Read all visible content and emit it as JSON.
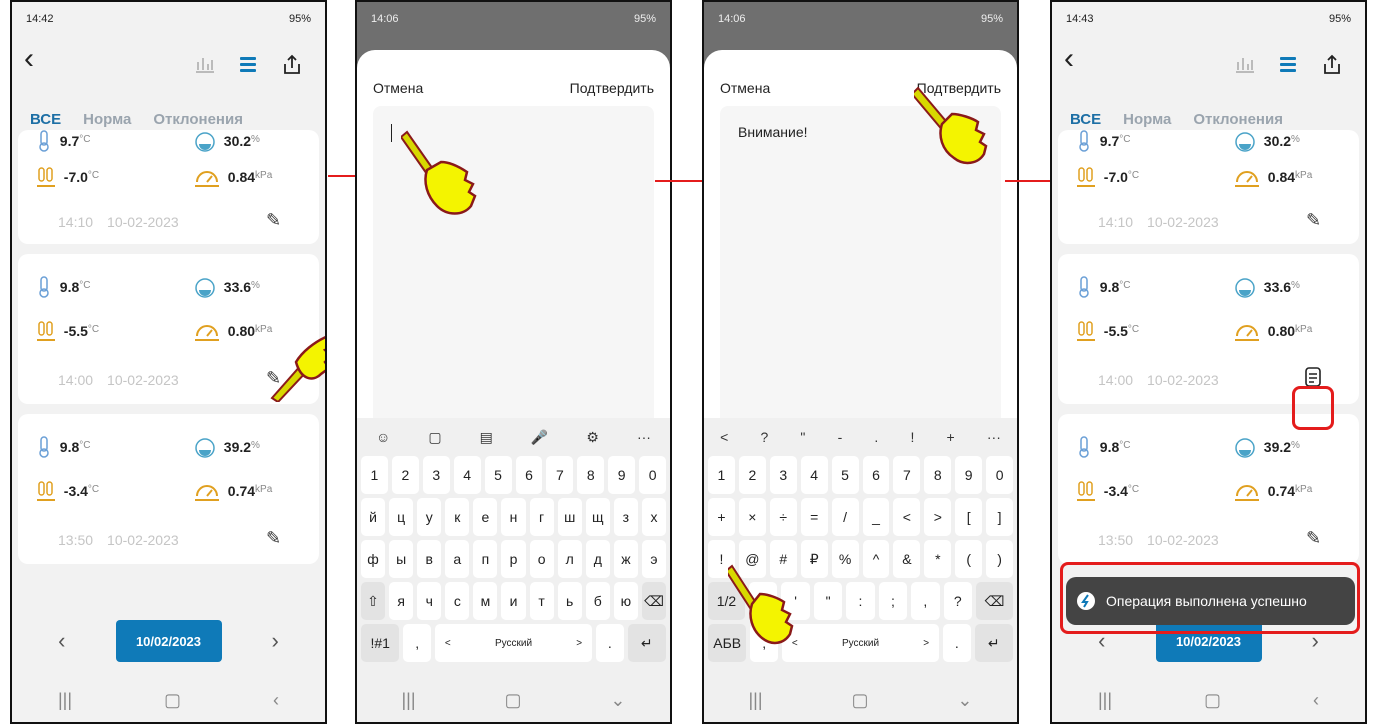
{
  "panels": {
    "p1": {
      "time": "14:42",
      "battery": "95%",
      "tabs": [
        "ВСЕ",
        "Норма",
        "Отклонения"
      ],
      "cards": [
        {
          "t1": "9.7",
          "t1u": "°C",
          "h1": "30.2",
          "h1u": "%",
          "t2": "-7.0",
          "t2u": "°C",
          "p": "0.84",
          "pu": "kPa",
          "time": "14:10",
          "date": "10-02-2023"
        },
        {
          "t1": "9.8",
          "t1u": "°C",
          "h1": "33.6",
          "h1u": "%",
          "t2": "-5.5",
          "t2u": "°C",
          "p": "0.80",
          "pu": "kPa",
          "time": "14:00",
          "date": "10-02-2023"
        },
        {
          "t1": "9.8",
          "t1u": "°C",
          "h1": "39.2",
          "h1u": "%",
          "t2": "-3.4",
          "t2u": "°C",
          "p": "0.74",
          "pu": "kPa",
          "time": "13:50",
          "date": "10-02-2023"
        }
      ],
      "date": "10/02/2023"
    },
    "p2": {
      "time": "14:06",
      "battery": "95%",
      "cancel": "Отмена",
      "confirm": "Подтвердить",
      "text": "",
      "tool": [
        "☺",
        "▢",
        "▤",
        "🎤",
        "⚙",
        "···"
      ],
      "rows": [
        [
          "1",
          "2",
          "3",
          "4",
          "5",
          "6",
          "7",
          "8",
          "9",
          "0"
        ],
        [
          "й",
          "ц",
          "у",
          "к",
          "е",
          "н",
          "г",
          "ш",
          "щ",
          "з",
          "х"
        ],
        [
          "ф",
          "ы",
          "в",
          "а",
          "п",
          "р",
          "о",
          "л",
          "д",
          "ж",
          "э"
        ],
        [
          "⇧",
          "я",
          "ч",
          "с",
          "м",
          "и",
          "т",
          "ь",
          "б",
          "ю",
          "⌫"
        ]
      ],
      "bottom": [
        "!#1",
        ",",
        "<",
        "Русский",
        ">",
        ".",
        "↵"
      ]
    },
    "p3": {
      "time": "14:06",
      "battery": "95%",
      "cancel": "Отмена",
      "confirm": "Подтвердить",
      "text": "Внимание!",
      "tool": [
        "<",
        "?",
        "\"",
        "-",
        ".",
        "!",
        "+",
        "···"
      ],
      "rows": [
        [
          "1",
          "2",
          "3",
          "4",
          "5",
          "6",
          "7",
          "8",
          "9",
          "0"
        ],
        [
          "+",
          "×",
          "÷",
          "=",
          "/",
          "_",
          "<",
          ">",
          "[",
          "]"
        ],
        [
          "!",
          "@",
          "#",
          "₽",
          "%",
          "^",
          "&",
          "*",
          "(",
          ")"
        ],
        [
          "1/2",
          "-",
          "'",
          "\"",
          ":",
          ";",
          ",",
          "?",
          "⌫"
        ]
      ],
      "bottom": [
        "АБВ",
        ",",
        "<",
        "Русский",
        ">",
        ".",
        "↵"
      ]
    },
    "p4": {
      "time": "14:43",
      "battery": "95%",
      "tabs": [
        "ВСЕ",
        "Норма",
        "Отклонения"
      ],
      "cards": [
        {
          "t1": "9.7",
          "t1u": "°C",
          "h1": "30.2",
          "h1u": "%",
          "t2": "-7.0",
          "t2u": "°C",
          "p": "0.84",
          "pu": "kPa",
          "time": "14:10",
          "date": "10-02-2023"
        },
        {
          "t1": "9.8",
          "t1u": "°C",
          "h1": "33.6",
          "h1u": "%",
          "t2": "-5.5",
          "t2u": "°C",
          "p": "0.80",
          "pu": "kPa",
          "time": "14:00",
          "date": "10-02-2023"
        },
        {
          "t1": "9.8",
          "t1u": "°C",
          "h1": "39.2",
          "h1u": "%",
          "t2": "-3.4",
          "t2u": "°C",
          "p": "0.74",
          "pu": "kPa",
          "time": "13:50",
          "date": "10-02-2023"
        }
      ],
      "toast": "Операция выполнена успешно",
      "date": "10/02/2023"
    }
  },
  "colors": {
    "accent": "#0f7ab8",
    "red": "#e41c1c",
    "temp": "#6a9fd6",
    "humid": "#4aa3c8",
    "orange": "#e0a020"
  }
}
